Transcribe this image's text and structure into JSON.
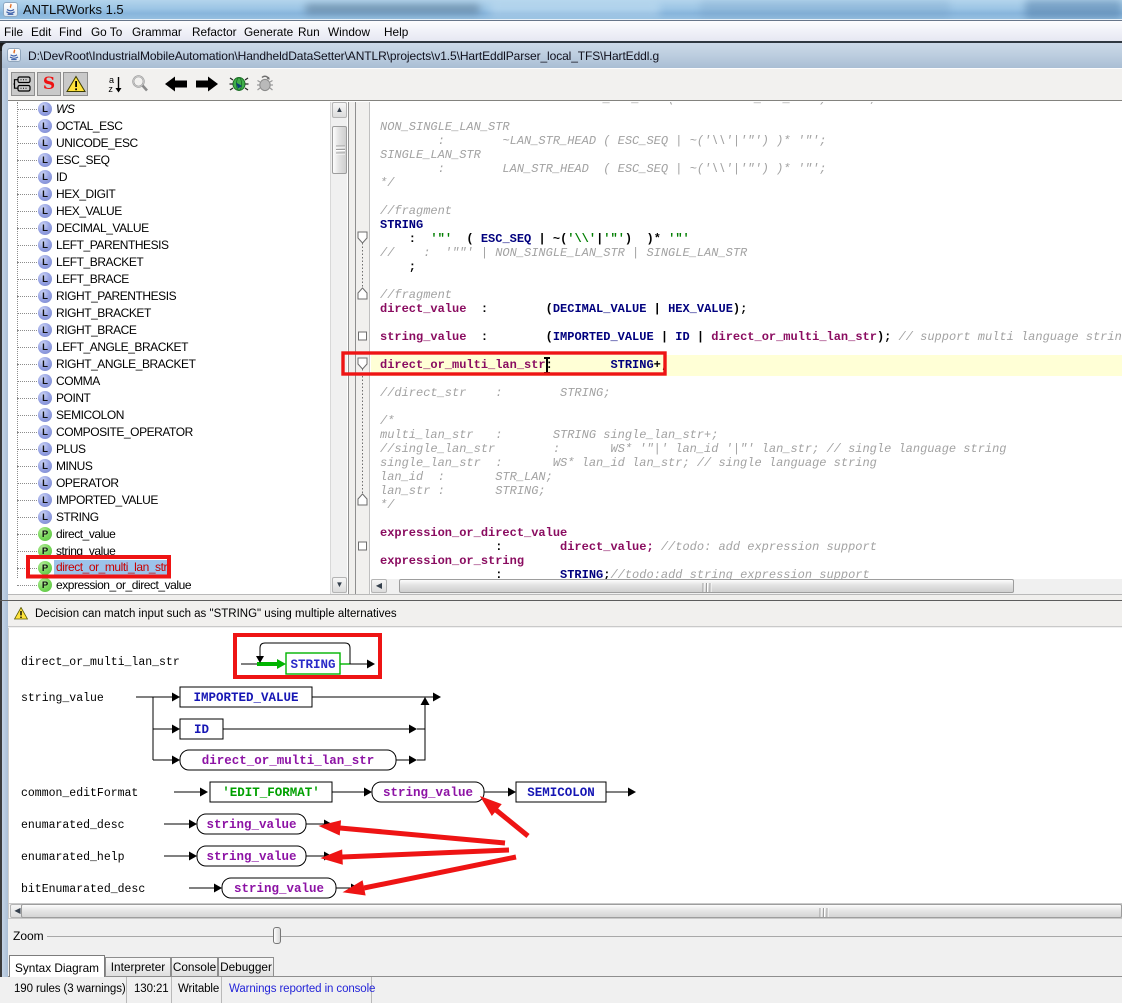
{
  "window": {
    "title": "ANTLRWorks 1.5",
    "app_icon": "java-cup-icon"
  },
  "menu": {
    "items": [
      "File",
      "Edit",
      "Find",
      "Go To",
      "Grammar",
      "Refactor",
      "Generate",
      "Run",
      "Window",
      "Help"
    ]
  },
  "document_bar": {
    "path": "D:\\DevRoot\\IndustrialMobileAutomation\\HandheldDataSetter\\ANTLR\\projects\\v1.5\\HartEddlParser_local_TFS\\HartEddl.g"
  },
  "toolbar": {
    "buttons": [
      {
        "name": "syntax-diagram-toggle",
        "pressed": true
      },
      {
        "name": "rule-info-toggle",
        "label": "S",
        "pressed": true
      },
      {
        "name": "warnings-toggle",
        "pressed": true
      },
      {
        "name": "sort-rules"
      },
      {
        "name": "find"
      },
      {
        "name": "back"
      },
      {
        "name": "forward"
      },
      {
        "name": "debug"
      },
      {
        "name": "debug-remote"
      }
    ],
    "s_label": "S"
  },
  "rule_list": {
    "items": [
      {
        "label": "WS",
        "kind": "lexer",
        "italic": true
      },
      {
        "label": "OCTAL_ESC",
        "kind": "lexer"
      },
      {
        "label": "UNICODE_ESC",
        "kind": "lexer"
      },
      {
        "label": "ESC_SEQ",
        "kind": "lexer"
      },
      {
        "label": "ID",
        "kind": "lexer"
      },
      {
        "label": "HEX_DIGIT",
        "kind": "lexer"
      },
      {
        "label": "HEX_VALUE",
        "kind": "lexer"
      },
      {
        "label": "DECIMAL_VALUE",
        "kind": "lexer"
      },
      {
        "label": "LEFT_PARENTHESIS",
        "kind": "lexer"
      },
      {
        "label": "LEFT_BRACKET",
        "kind": "lexer"
      },
      {
        "label": "LEFT_BRACE",
        "kind": "lexer"
      },
      {
        "label": "RIGHT_PARENTHESIS",
        "kind": "lexer"
      },
      {
        "label": "RIGHT_BRACKET",
        "kind": "lexer"
      },
      {
        "label": "RIGHT_BRACE",
        "kind": "lexer"
      },
      {
        "label": "LEFT_ANGLE_BRACKET",
        "kind": "lexer"
      },
      {
        "label": "RIGHT_ANGLE_BRACKET",
        "kind": "lexer"
      },
      {
        "label": "COMMA",
        "kind": "lexer"
      },
      {
        "label": "POINT",
        "kind": "lexer"
      },
      {
        "label": "SEMICOLON",
        "kind": "lexer"
      },
      {
        "label": "COMPOSITE_OPERATOR",
        "kind": "lexer"
      },
      {
        "label": "PLUS",
        "kind": "lexer"
      },
      {
        "label": "MINUS",
        "kind": "lexer"
      },
      {
        "label": "OPERATOR",
        "kind": "lexer"
      },
      {
        "label": "IMPORTED_VALUE",
        "kind": "lexer"
      },
      {
        "label": "STRING",
        "kind": "lexer"
      },
      {
        "label": "direct_value",
        "kind": "parser"
      },
      {
        "label": "string_value",
        "kind": "parser"
      },
      {
        "label": "direct_or_multi_lan_str",
        "kind": "parser",
        "selected": true,
        "warning": true
      },
      {
        "label": "expression_or_direct_value",
        "kind": "parser"
      }
    ]
  },
  "editor": {
    "lines": [
      {
        "segs": [
          [
            "c",
            "          :          '\"' DOUBLE_LAN_STR ( '\"' DOUBLE_LAN_STR )* '\"' ;   */"
          ]
        ]
      },
      {
        "segs": []
      },
      {
        "segs": [
          [
            "c",
            "NON_SINGLE_LAN_STR"
          ]
        ]
      },
      {
        "segs": [
          [
            "c",
            "        :        ~LAN_STR_HEAD ( ESC_SEQ | ~('\\\\'|'\"') )* '\"';"
          ]
        ]
      },
      {
        "segs": [
          [
            "c",
            "SINGLE_LAN_STR"
          ]
        ]
      },
      {
        "segs": [
          [
            "c",
            "        :        LAN_STR_HEAD  ( ESC_SEQ | ~('\\\\'|'\"') )* '\"';"
          ]
        ]
      },
      {
        "segs": [
          [
            "c",
            "*/"
          ]
        ]
      },
      {
        "segs": []
      },
      {
        "segs": [
          [
            "c",
            "//fragment"
          ]
        ]
      },
      {
        "segs": [
          [
            "t",
            "STRING"
          ]
        ]
      },
      {
        "segs": [
          [
            "p",
            "    :  "
          ],
          [
            "s",
            "'\"'"
          ],
          [
            "p",
            "  ( "
          ],
          [
            "t",
            "ESC_SEQ"
          ],
          [
            "p",
            " | ~("
          ],
          [
            "s",
            "'\\\\'"
          ],
          [
            "p",
            "|"
          ],
          [
            "s",
            "'\"'"
          ],
          [
            "p",
            ")  )* "
          ],
          [
            "s",
            "'\"'"
          ]
        ]
      },
      {
        "segs": [
          [
            "c",
            "//    :  '\"\"' | NON_SINGLE_LAN_STR | SINGLE_LAN_STR"
          ]
        ]
      },
      {
        "segs": [
          [
            "p",
            "    ;"
          ]
        ]
      },
      {
        "segs": []
      },
      {
        "segs": [
          [
            "c",
            "//fragment"
          ]
        ]
      },
      {
        "segs": [
          [
            "r",
            "direct_value"
          ],
          [
            "p",
            "  :        ("
          ],
          [
            "t",
            "DECIMAL_VALUE"
          ],
          [
            "p",
            " | "
          ],
          [
            "t",
            "HEX_VALUE"
          ],
          [
            "p",
            ");"
          ]
        ]
      },
      {
        "segs": []
      },
      {
        "segs": [
          [
            "r",
            "string_value"
          ],
          [
            "p",
            "  :        ("
          ],
          [
            "t",
            "IMPORTED_VALUE"
          ],
          [
            "p",
            " | "
          ],
          [
            "t",
            "ID"
          ],
          [
            "p",
            " | "
          ],
          [
            "r",
            "direct_or_multi_lan_str"
          ],
          [
            "p",
            ");"
          ],
          [
            "c",
            " // support multi language string"
          ]
        ]
      },
      {
        "segs": []
      },
      {
        "segs": [
          [
            "r",
            "direct_or_multi_lan_str"
          ],
          [
            "p",
            ":        "
          ],
          [
            "t",
            "STRING"
          ],
          [
            "p",
            "+;"
          ]
        ],
        "current": true
      },
      {
        "segs": []
      },
      {
        "segs": [
          [
            "c",
            "//direct_str    :        STRING;"
          ]
        ]
      },
      {
        "segs": []
      },
      {
        "segs": [
          [
            "c",
            "/*"
          ]
        ]
      },
      {
        "segs": [
          [
            "c",
            "multi_lan_str   :       STRING single_lan_str+;"
          ]
        ]
      },
      {
        "segs": [
          [
            "c",
            "//single_lan_str        :       WS* '\"|' lan_id '|\"' lan_str; // single language string"
          ]
        ]
      },
      {
        "segs": [
          [
            "c",
            "single_lan_str  :       WS* lan_id lan_str; // single language string"
          ]
        ]
      },
      {
        "segs": [
          [
            "c",
            "lan_id  :       STR_LAN;"
          ]
        ]
      },
      {
        "segs": [
          [
            "c",
            "lan_str :       STRING;"
          ]
        ]
      },
      {
        "segs": [
          [
            "c",
            "*/"
          ]
        ]
      },
      {
        "segs": []
      },
      {
        "segs": [
          [
            "r",
            "expression_or_direct_value"
          ]
        ]
      },
      {
        "segs": [
          [
            "p",
            "                :        "
          ],
          [
            "r",
            "direct_value;"
          ],
          [
            "c",
            " //todo: add expression support"
          ]
        ]
      },
      {
        "segs": [
          [
            "r",
            "expression_or_string"
          ]
        ]
      },
      {
        "segs": [
          [
            "p",
            "                :        "
          ],
          [
            "t",
            "STRING"
          ],
          [
            "p",
            ";"
          ],
          [
            "c",
            "//todo:add string expression support"
          ]
        ]
      }
    ]
  },
  "warning_bar": {
    "message": "Decision can match input such as \"STRING\" using multiple alternatives"
  },
  "diagram": {
    "rows": [
      {
        "label": "direct_or_multi_lan_str"
      },
      {
        "label": "string_value"
      },
      {
        "label": "common_editFormat"
      },
      {
        "label": "enumarated_desc"
      },
      {
        "label": "enumarated_help"
      },
      {
        "label": "bitEnumarated_desc"
      }
    ],
    "boxes": {
      "string": "STRING",
      "imported_value": "IMPORTED_VALUE",
      "id": "ID",
      "direct_or_multi_lan_str": "direct_or_multi_lan_str",
      "edit_format": "'EDIT_FORMAT'",
      "string_value": "string_value",
      "semicolon": "SEMICOLON"
    }
  },
  "zoom": {
    "label": "Zoom"
  },
  "tabs": {
    "items": [
      "Syntax Diagram",
      "Interpreter",
      "Console",
      "Debugger"
    ],
    "active": "Syntax Diagram"
  },
  "status": {
    "rules": "190 rules (3 warnings)",
    "caret_position": "130:21",
    "writable": "Writable",
    "message": "Warnings reported in console"
  },
  "colors": {
    "annotation_red": "#ee1414",
    "selection_blue": "#9cc3ea",
    "current_line_yellow": "#ffffd6",
    "lexer_token_blue": "#00007e",
    "parser_rule_purple": "#8a0c60",
    "string_literal_green": "#007e00",
    "comment_gray": "#9c9c9c"
  }
}
